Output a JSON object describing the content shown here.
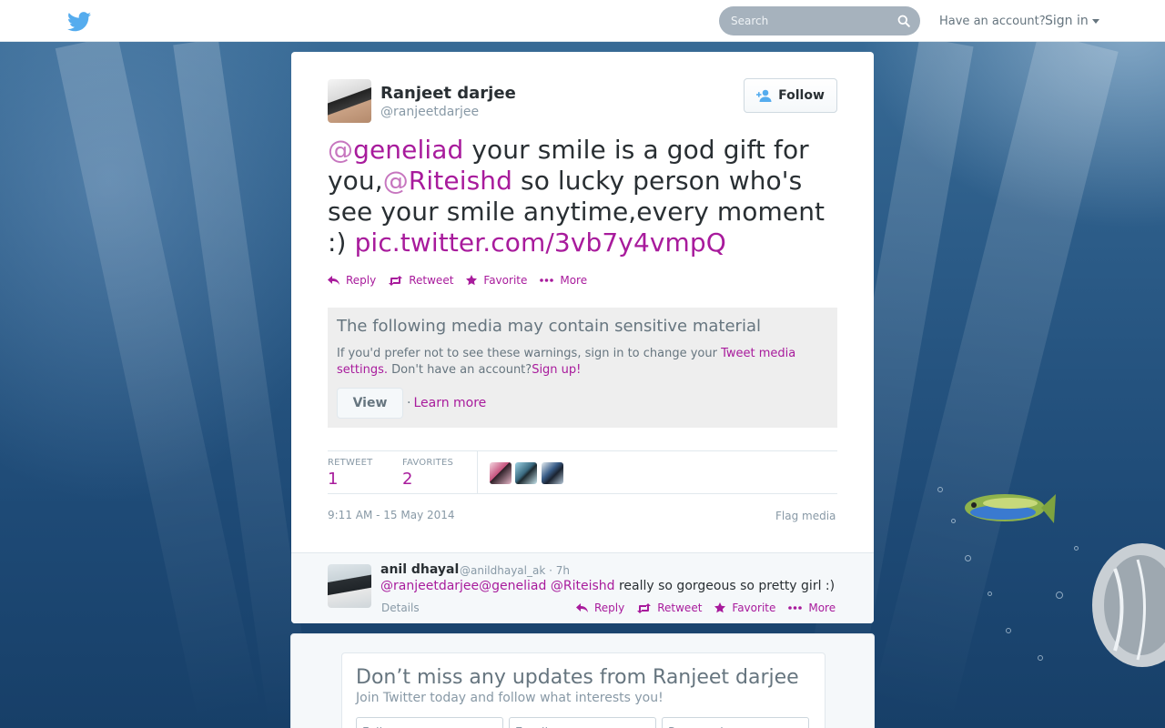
{
  "colors": {
    "link": "#a81b9c",
    "text": "#292f33",
    "muted": "#8899a6"
  },
  "topbar": {
    "logo_icon": "twitter-bird-icon",
    "search_placeholder": "Search",
    "have_account": "Have an account?",
    "sign_in": "Sign in"
  },
  "tweet": {
    "author_name": "Ranjeet darjee",
    "author_handle": "@ranjeetdarjee",
    "follow_label": "Follow",
    "text_parts": {
      "m1_at": "@",
      "m1_user": "geneliad",
      "t1": " your smile is a god gift for you,",
      "m2_at": "@",
      "m2_user": "Riteishd",
      "t2": " so lucky person who's see your smile anytime,every moment :) ",
      "link": "pic.twitter.com/3vb7y4vmpQ"
    },
    "actions": {
      "reply": "Reply",
      "retweet": "Retweet",
      "favorite": "Favorite",
      "more": "More"
    },
    "sensitive": {
      "title": "The following media may contain sensitive material",
      "body_prefix": "If you'd prefer not to see these warnings, sign in to change your ",
      "settings_link": "Tweet media settings.",
      "body_mid": " Don't have an account?",
      "signup_link": "Sign up!",
      "view_label": "View",
      "separator": "·",
      "learn_more": "Learn more"
    },
    "stats": {
      "retweet_label": "RETWEET",
      "retweet_count": "1",
      "favorites_label": "FAVORITES",
      "favorites_count": "2"
    },
    "timestamp": "9:11 AM - 15 May 2014",
    "flag_media": "Flag media"
  },
  "reply": {
    "name": "anil dhayal",
    "meta": "@anildhayal_ak · 7h",
    "mentions": [
      "@ranjeetdarjee",
      "@geneliad",
      "@Riteishd"
    ],
    "text": " really so gorgeous so pretty girl :)",
    "details": "Details",
    "actions": {
      "reply": "Reply",
      "retweet": "Retweet",
      "favorite": "Favorite",
      "more": "More"
    }
  },
  "signup": {
    "title": "Don’t miss any updates from Ranjeet darjee",
    "subtitle": "Join Twitter today and follow what interests you!",
    "full_name_placeholder": "Full name",
    "email_placeholder": "Email",
    "password_placeholder": "Password"
  }
}
